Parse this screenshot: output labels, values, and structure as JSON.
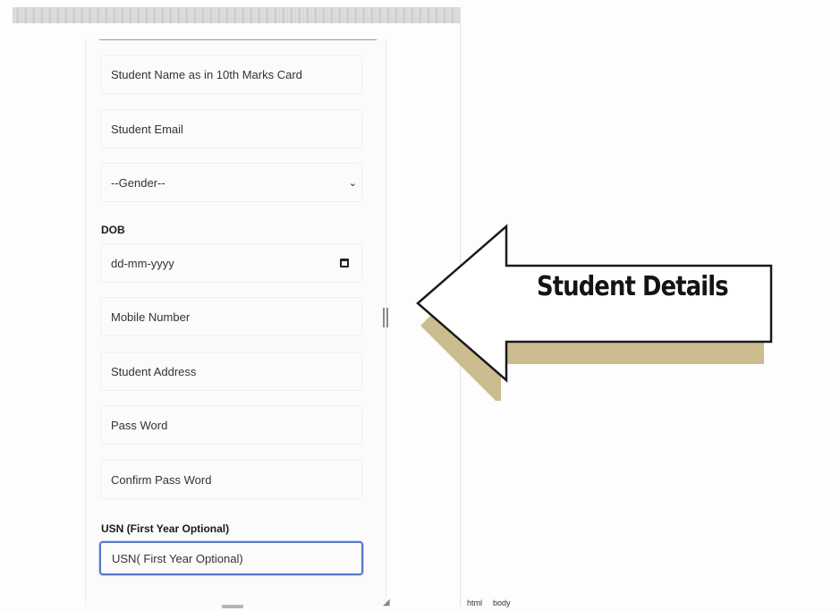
{
  "form": {
    "name_placeholder": "Student  Name as in 10th Marks Card",
    "email_placeholder": "Student Email",
    "gender_placeholder": "--Gender--",
    "dob_label": "DOB",
    "dob_placeholder": "dd-mm-yyyy",
    "mobile_placeholder": "Mobile Number",
    "address_placeholder": "Student Address",
    "password_placeholder": "Pass Word",
    "confirm_password_placeholder": "Confirm Pass Word",
    "usn_label": "USN (First Year Optional)",
    "usn_placeholder": "USN( First Year Optional)"
  },
  "annotation": {
    "text": "Student Details",
    "colors": {
      "arrow_fill": "#ffffff",
      "arrow_stroke": "#1a1a1a",
      "arrow_shadow": "#c8b98a"
    }
  },
  "status_bar": {
    "crumbs": [
      "html",
      "body"
    ]
  },
  "icons": {
    "gender_dropdown": "chevron-down-icon",
    "dob_picker": "calendar-icon"
  },
  "colors": {
    "focus_border": "#5a78c8"
  }
}
